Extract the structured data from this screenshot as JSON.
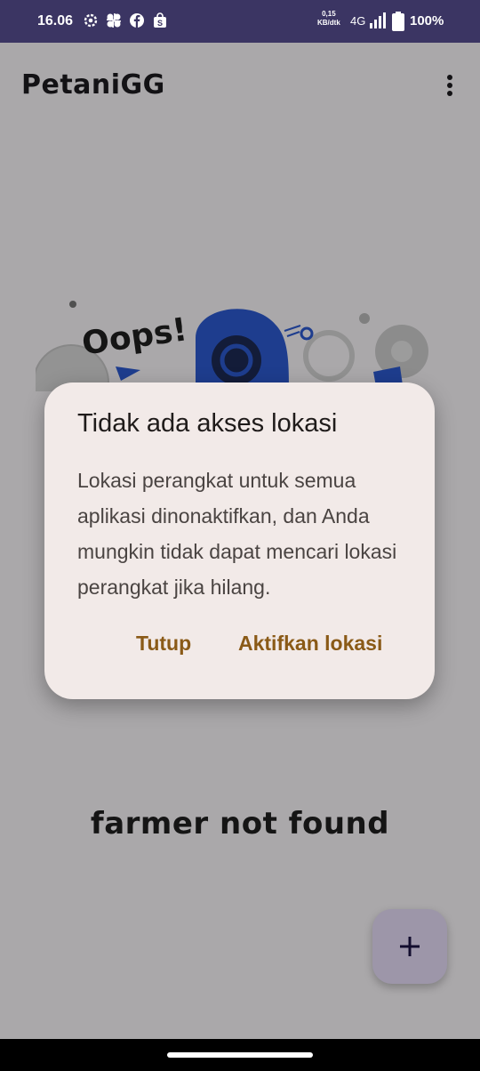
{
  "status_bar": {
    "time": "16.06",
    "speed_value": "0,15",
    "speed_unit": "KB/dtk",
    "network": "4G",
    "battery": "100%",
    "icons": [
      "gear-icon",
      "pinwheel-icon",
      "facebook-icon",
      "shopping-bag-icon",
      "signal-icon",
      "battery-icon"
    ]
  },
  "app_bar": {
    "title": "PetaniGG",
    "menu_icon": "more-vert-icon"
  },
  "illustration": {
    "oops_text": "Oops!"
  },
  "empty_state": {
    "message": "farmer not found"
  },
  "fab": {
    "icon": "plus-icon"
  },
  "dialog": {
    "title": "Tidak ada akses lokasi",
    "body": "Lokasi perangkat untuk semua aplikasi dinonaktifkan, dan Anda mungkin tidak dapat mencari lokasi perangkat jika hilang.",
    "close_label": "Tutup",
    "enable_label": "Aktifkan lokasi"
  },
  "colors": {
    "status_bar": "#3b3563",
    "dialog_bg": "#f2eae8",
    "button_text": "#8a5a17",
    "fab_bg": "#e7defa",
    "illustration_blue": "#2d5bd1"
  }
}
